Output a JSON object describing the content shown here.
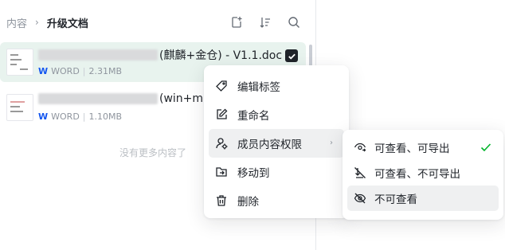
{
  "breadcrumb": {
    "root": "内容",
    "separator": "›",
    "current": "升级文档"
  },
  "header_icons": [
    "new-doc-icon",
    "sort-icon",
    "search-icon"
  ],
  "files": [
    {
      "name_tail": "(麒麟+金仓) - V1.1.doc",
      "type": "WORD",
      "size": "2.31MB",
      "selected": true
    },
    {
      "name_tail": "(win+m",
      "type": "WORD",
      "size": "1.10MB",
      "selected": false
    }
  ],
  "empty_hint": "没有更多内容了",
  "context_menu": [
    {
      "label": "编辑标签",
      "icon": "tag-icon"
    },
    {
      "label": "重命名",
      "icon": "rename-icon"
    },
    {
      "label": "成员内容权限",
      "icon": "member-permission-icon",
      "has_submenu": true
    },
    {
      "label": "移动到",
      "icon": "move-folder-icon"
    },
    {
      "label": "删除",
      "icon": "trash-icon"
    }
  ],
  "submenu": [
    {
      "label": "可查看、可导出",
      "icon": "view-export-icon",
      "checked": true
    },
    {
      "label": "可查看、不可导出",
      "icon": "no-export-icon",
      "checked": false
    },
    {
      "label": "不可查看",
      "icon": "eye-off-icon",
      "checked": false
    }
  ],
  "colors": {
    "accent": "#00b42a",
    "selected_row": "#e8f3ee",
    "word_blue": "#1456f0"
  }
}
